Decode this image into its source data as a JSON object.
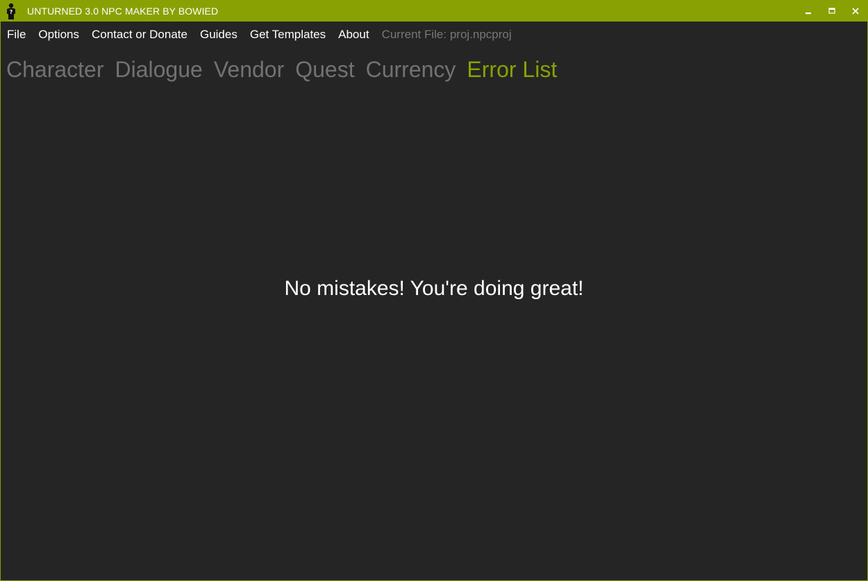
{
  "window": {
    "title": "UNTURNED 3.0 NPC MAKER BY BOWIED",
    "app_icon": "npc-silhouette-icon",
    "controls": {
      "minimize_icon": "minimize-icon",
      "maximize_icon": "maximize-icon",
      "close_icon": "close-icon"
    }
  },
  "menu": {
    "items": [
      {
        "label": "File"
      },
      {
        "label": "Options"
      },
      {
        "label": "Contact or Donate"
      },
      {
        "label": "Guides"
      },
      {
        "label": "Get Templates"
      },
      {
        "label": "About"
      }
    ],
    "current_file": "Current File: proj.npcproj"
  },
  "tabs": [
    {
      "label": "Character",
      "active": false
    },
    {
      "label": "Dialogue",
      "active": false
    },
    {
      "label": "Vendor",
      "active": false
    },
    {
      "label": "Quest",
      "active": false
    },
    {
      "label": "Currency",
      "active": false
    },
    {
      "label": "Error List",
      "active": true
    }
  ],
  "main": {
    "message": "No mistakes! You're doing great!"
  },
  "colors": {
    "accent": "#8aa104",
    "background": "#252525",
    "inactive_tab": "#727272",
    "muted_text": "#777777",
    "text": "#ffffff"
  }
}
